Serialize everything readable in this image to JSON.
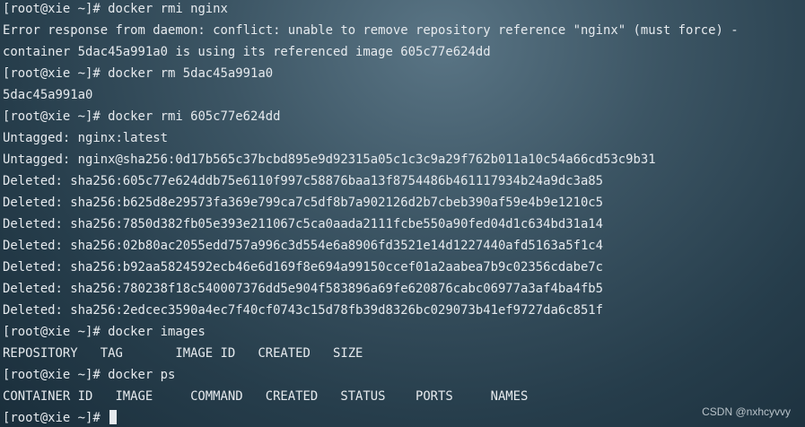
{
  "terminal": {
    "lines": [
      {
        "prompt": "[root@xie ~]# ",
        "text": "docker rmi nginx"
      },
      {
        "prompt": "",
        "text": "Error response from daemon: conflict: unable to remove repository reference \"nginx\" (must force) -"
      },
      {
        "prompt": "",
        "text": "container 5dac45a991a0 is using its referenced image 605c77e624dd"
      },
      {
        "prompt": "[root@xie ~]# ",
        "text": "docker rm 5dac45a991a0"
      },
      {
        "prompt": "",
        "text": "5dac45a991a0"
      },
      {
        "prompt": "[root@xie ~]# ",
        "text": "docker rmi 605c77e624dd"
      },
      {
        "prompt": "",
        "text": "Untagged: nginx:latest"
      },
      {
        "prompt": "",
        "text": "Untagged: nginx@sha256:0d17b565c37bcbd895e9d92315a05c1c3c9a29f762b011a10c54a66cd53c9b31"
      },
      {
        "prompt": "",
        "text": "Deleted: sha256:605c77e624ddb75e6110f997c58876baa13f8754486b461117934b24a9dc3a85"
      },
      {
        "prompt": "",
        "text": "Deleted: sha256:b625d8e29573fa369e799ca7c5df8b7a902126d2b7cbeb390af59e4b9e1210c5"
      },
      {
        "prompt": "",
        "text": "Deleted: sha256:7850d382fb05e393e211067c5ca0aada2111fcbe550a90fed04d1c634bd31a14"
      },
      {
        "prompt": "",
        "text": "Deleted: sha256:02b80ac2055edd757a996c3d554e6a8906fd3521e14d1227440afd5163a5f1c4"
      },
      {
        "prompt": "",
        "text": "Deleted: sha256:b92aa5824592ecb46e6d169f8e694a99150ccef01a2aabea7b9c02356cdabe7c"
      },
      {
        "prompt": "",
        "text": "Deleted: sha256:780238f18c540007376dd5e904f583896a69fe620876cabc06977a3af4ba4fb5"
      },
      {
        "prompt": "",
        "text": "Deleted: sha256:2edcec3590a4ec7f40cf0743c15d78fb39d8326bc029073b41ef9727da6c851f"
      },
      {
        "prompt": "[root@xie ~]# ",
        "text": "docker images"
      },
      {
        "prompt": "",
        "text": "REPOSITORY   TAG       IMAGE ID   CREATED   SIZE"
      },
      {
        "prompt": "[root@xie ~]# ",
        "text": "docker ps"
      },
      {
        "prompt": "",
        "text": "CONTAINER ID   IMAGE     COMMAND   CREATED   STATUS    PORTS     NAMES"
      },
      {
        "prompt": "[root@xie ~]# ",
        "text": ""
      }
    ]
  },
  "watermark": {
    "text": "CSDN @nxhcyvvy"
  }
}
